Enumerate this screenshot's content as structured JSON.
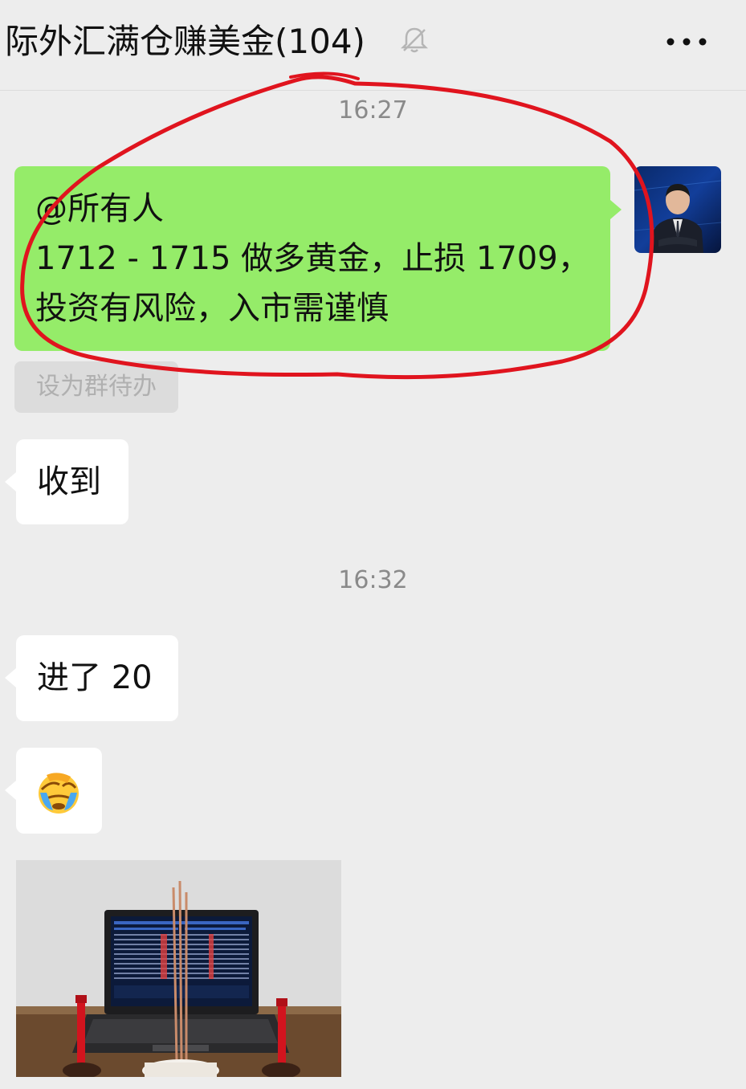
{
  "header": {
    "title": "际外汇满仓赚美金(104)",
    "mute_icon": "bell-off-icon",
    "more_icon": "more-dots-icon"
  },
  "messages": [
    {
      "type": "time",
      "text": "16:27"
    },
    {
      "type": "text",
      "side": "right",
      "color": "#95ec69",
      "lines": [
        "@所有人",
        "1712 - 1715 做多黄金，止损 1709，",
        "投资有风险，入市需谨慎"
      ]
    },
    {
      "type": "action",
      "text": "设为群待办"
    },
    {
      "type": "text",
      "side": "left",
      "color": "#ffffff",
      "lines": [
        "收到"
      ]
    },
    {
      "type": "time",
      "text": "16:32"
    },
    {
      "type": "text",
      "side": "left",
      "color": "#ffffff",
      "lines": [
        "进了 20"
      ]
    },
    {
      "type": "emoji",
      "side": "left",
      "icon": "facepalm-crying-emoji"
    },
    {
      "type": "image",
      "side": "left",
      "icon": "laptop-incense-photo"
    }
  ],
  "colors": {
    "background": "#ededed",
    "sent_bubble": "#95ec69",
    "received_bubble": "#ffffff",
    "annotation_circle": "#e0141e"
  }
}
